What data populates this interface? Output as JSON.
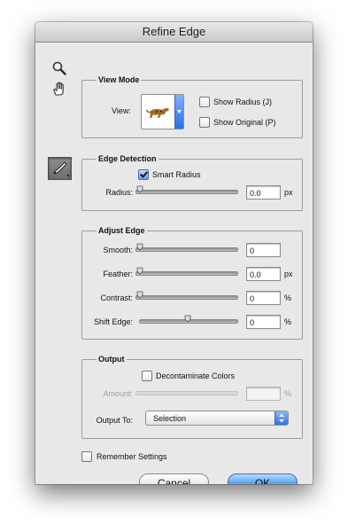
{
  "window": {
    "title": "Refine Edge"
  },
  "tools": {
    "zoom": "zoom-icon",
    "hand": "hand-icon",
    "refine_radius": "refine-radius-brush-icon"
  },
  "view_mode": {
    "title": "View Mode",
    "view_label": "View:",
    "show_radius_label": "Show Radius (J)",
    "show_radius_checked": false,
    "show_original_label": "Show Original (P)",
    "show_original_checked": false
  },
  "edge_detection": {
    "title": "Edge Detection",
    "smart_radius_label": "Smart Radius",
    "smart_radius_checked": true,
    "radius_label": "Radius:",
    "radius_value": "0.0",
    "radius_unit": "px",
    "radius_fraction": 0.0
  },
  "adjust_edge": {
    "title": "Adjust Edge",
    "smooth_label": "Smooth:",
    "smooth_value": "0",
    "smooth_fraction": 0.0,
    "feather_label": "Feather:",
    "feather_value": "0.0",
    "feather_unit": "px",
    "feather_fraction": 0.0,
    "contrast_label": "Contrast:",
    "contrast_value": "0",
    "contrast_unit": "%",
    "contrast_fraction": 0.0,
    "shift_label": "Shift Edge:",
    "shift_value": "0",
    "shift_unit": "%",
    "shift_fraction": 0.5
  },
  "output": {
    "title": "Output",
    "decontaminate_label": "Decontaminate Colors",
    "decontaminate_checked": false,
    "amount_label": "Amount:",
    "amount_value": "",
    "amount_unit": "%",
    "output_to_label": "Output To:",
    "output_to_value": "Selection"
  },
  "remember_settings_label": "Remember Settings",
  "remember_settings_checked": false,
  "buttons": {
    "cancel": "Cancel",
    "ok": "OK"
  }
}
